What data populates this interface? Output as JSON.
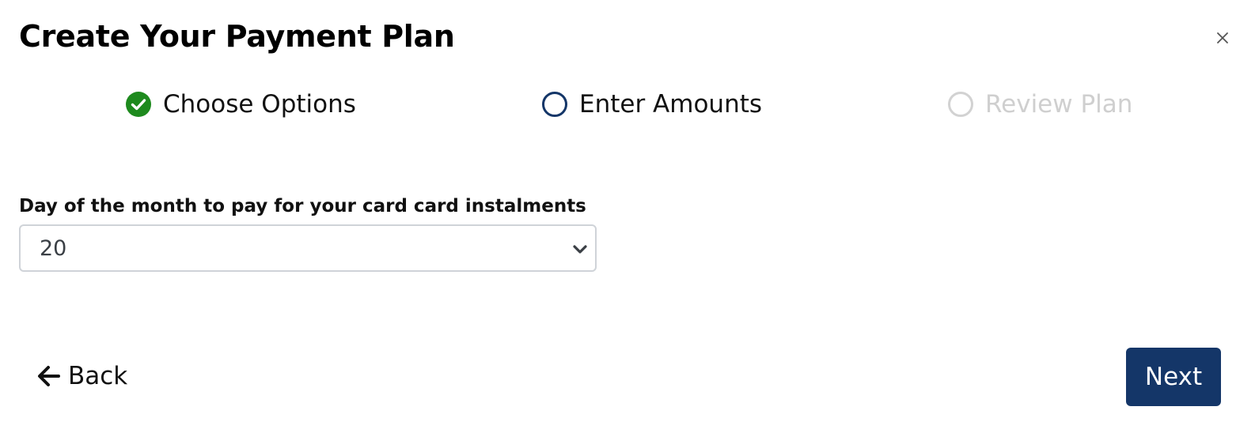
{
  "modal": {
    "title": "Create Your Payment Plan",
    "close_icon": "close-icon"
  },
  "stepper": {
    "steps": [
      {
        "label": "Choose Options",
        "state": "complete",
        "icon": "check-circle-icon",
        "color": "#1e8a1e"
      },
      {
        "label": "Enter Amounts",
        "state": "current",
        "icon": "circle-outline-icon",
        "color": "#143668"
      },
      {
        "label": "Review Plan",
        "state": "upcoming",
        "icon": "circle-outline-icon",
        "color": "#cfcfcf"
      }
    ]
  },
  "form": {
    "payment_day": {
      "label": "Day of the month to pay for your card card instalments",
      "value": "20",
      "icon": "chevron-down-icon"
    }
  },
  "footer": {
    "back_label": "Back",
    "back_icon": "arrow-left-icon",
    "next_label": "Next",
    "next_color": "#143668"
  }
}
